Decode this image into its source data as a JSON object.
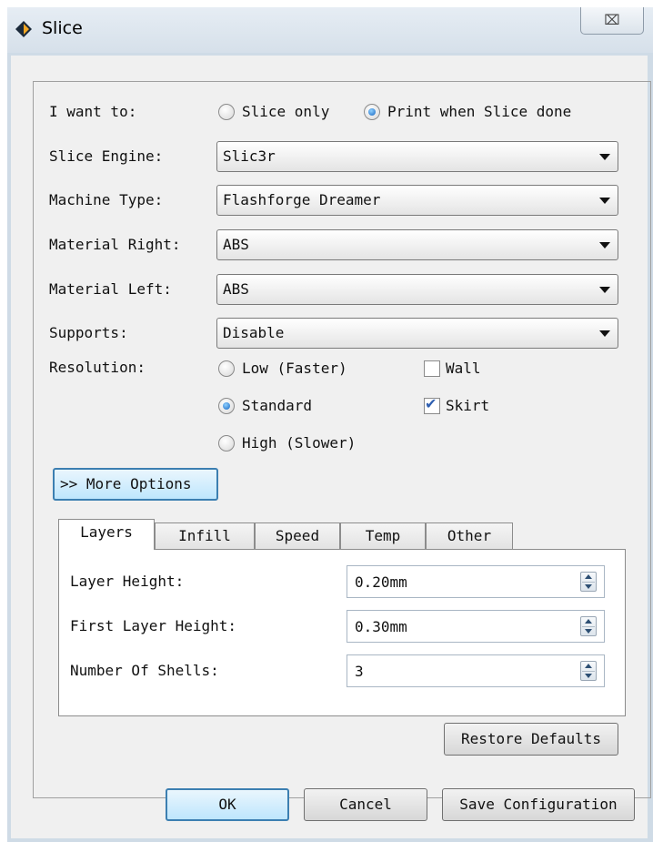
{
  "window": {
    "title": "Slice",
    "close_glyph": "⌧"
  },
  "form": {
    "want_label": "I want to:",
    "want_options": [
      {
        "label": "Slice only",
        "selected": false
      },
      {
        "label": "Print when Slice done",
        "selected": true
      }
    ],
    "engine": {
      "label": "Slice Engine:",
      "value": "Slic3r"
    },
    "machine": {
      "label": "Machine Type:",
      "value": "Flashforge Dreamer"
    },
    "material_right": {
      "label": "Material Right:",
      "value": "ABS"
    },
    "material_left": {
      "label": "Material Left:",
      "value": "ABS"
    },
    "supports": {
      "label": "Supports:",
      "value": "Disable"
    },
    "resolution": {
      "label": "Resolution:",
      "options": [
        {
          "label": "Low (Faster)",
          "selected": false
        },
        {
          "label": "Standard",
          "selected": true
        },
        {
          "label": "High (Slower)",
          "selected": false
        }
      ]
    },
    "wall": {
      "label": "Wall",
      "checked": false
    },
    "skirt": {
      "label": "Skirt",
      "checked": true
    }
  },
  "more_options_label": ">> More Options",
  "tabs": [
    {
      "label": "Layers",
      "active": true
    },
    {
      "label": "Infill",
      "active": false
    },
    {
      "label": "Speed",
      "active": false
    },
    {
      "label": "Temp",
      "active": false
    },
    {
      "label": "Other",
      "active": false
    }
  ],
  "layers": {
    "layer_height": {
      "label": "Layer Height:",
      "value": "0.20mm"
    },
    "first_layer_height": {
      "label": "First Layer Height:",
      "value": "0.30mm"
    },
    "shells": {
      "label": "Number Of Shells:",
      "value": "3"
    }
  },
  "buttons": {
    "restore": "Restore Defaults",
    "ok": "OK",
    "cancel": "Cancel",
    "save": "Save Configuration"
  },
  "colors": {
    "accent": "#3c7fb1",
    "check_mark": "#2f5fb0"
  }
}
